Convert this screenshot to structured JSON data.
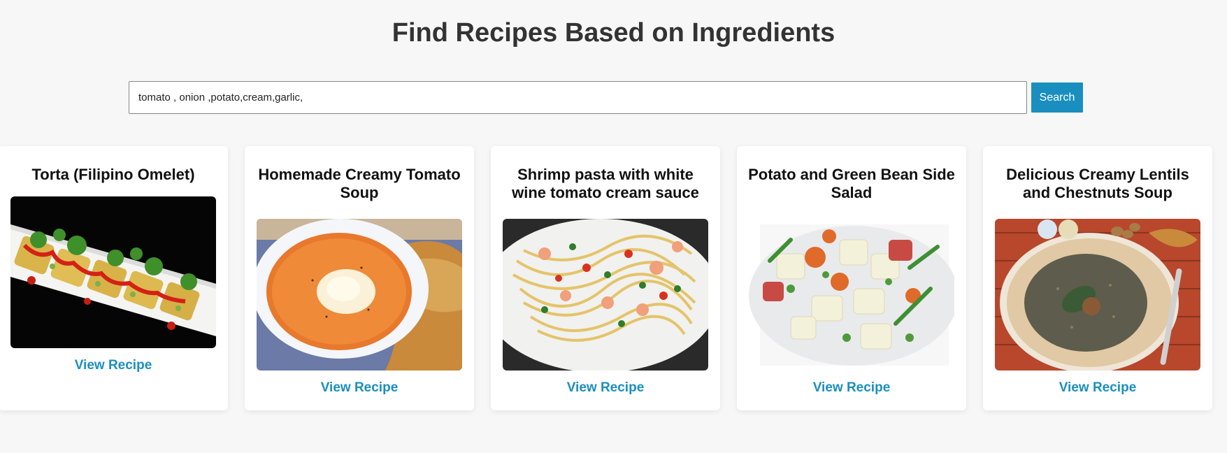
{
  "header": {
    "title": "Find Recipes Based on Ingredients"
  },
  "search": {
    "value": "tomato , onion ,potato,cream,garlic,",
    "button_label": "Search"
  },
  "recipes": [
    {
      "title": "Torta (Filipino Omelet)",
      "link_label": "View Recipe",
      "image": "omelet-photo"
    },
    {
      "title": "Homemade Creamy Tomato Soup",
      "link_label": "View Recipe",
      "image": "tomato-soup-photo"
    },
    {
      "title": "Shrimp pasta with white wine tomato cream sauce",
      "link_label": "View Recipe",
      "image": "shrimp-pasta-photo"
    },
    {
      "title": "Potato and Green Bean Side Salad",
      "link_label": "View Recipe",
      "image": "potato-salad-photo"
    },
    {
      "title": "Delicious Creamy Lentils and Chestnuts Soup",
      "link_label": "View Recipe",
      "image": "lentil-soup-photo"
    }
  ],
  "colors": {
    "accent": "#1a8fbf",
    "background": "#f7f7f7",
    "card": "#ffffff"
  }
}
